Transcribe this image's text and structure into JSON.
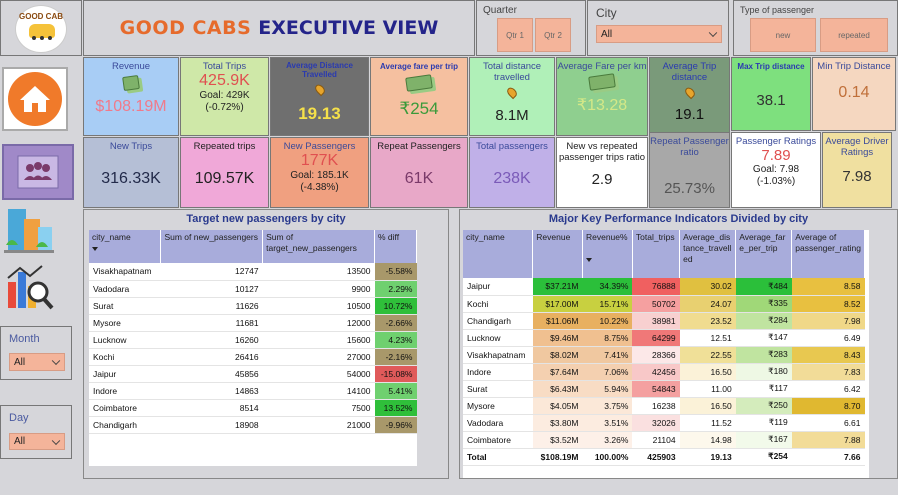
{
  "logo": {
    "text": "GOOD CAB"
  },
  "header": {
    "title_part1": "GOOD CABS",
    "title_part2": "EXECUTIVE VIEW"
  },
  "slicers": {
    "quarter": {
      "title": "Quarter",
      "options": [
        "Qtr 1",
        "Qtr 2"
      ]
    },
    "city": {
      "title": "City",
      "value": "All"
    },
    "passenger_type": {
      "title": "Type of passenger",
      "options": [
        "new",
        "repeated"
      ]
    },
    "month": {
      "title": "Month",
      "value": "All"
    },
    "day": {
      "title": "Day",
      "value": "All"
    }
  },
  "nav": [
    {
      "name": "home-icon"
    },
    {
      "name": "passengers-icon"
    },
    {
      "name": "city-buildings-icon"
    },
    {
      "name": "analytics-icon"
    }
  ],
  "kpis": {
    "revenue": {
      "title": "Revenue",
      "value": "$108.19M",
      "bg": "#a8cdf5"
    },
    "total_trips": {
      "title": "Total Trips",
      "value": "425.9K",
      "goal": "Goal: 429K",
      "diff": "(-0.72%)",
      "bg": "#cfe8a8"
    },
    "avg_distance": {
      "title": "Average Distance Travelled",
      "value": "19.13",
      "bg": "#6f6f6f"
    },
    "avg_fare": {
      "title": "Average fare per trip",
      "value": "₹254",
      "bg": "#f5c0a0"
    },
    "total_distance": {
      "title": "Total distance travelled",
      "value": "8.1M",
      "bg": "#b0f0b8"
    },
    "avg_fare_km": {
      "title": "Average Fare per km",
      "value": "₹13.28",
      "bg": "#8fcf8f"
    },
    "avg_trip_distance": {
      "title": "Average Trip distance",
      "value": "19.1",
      "bg": "#7a9a7a"
    },
    "max_trip_distance": {
      "title": "Max Trip distance",
      "value": "38.1",
      "bg": "#7ee07e"
    },
    "min_trip_distance": {
      "title": "Min Trip Distance",
      "value": "0.14",
      "bg": "#f5d7c0"
    },
    "new_trips": {
      "title": "New Trips",
      "value": "316.33K",
      "bg": "#b5bfd6"
    },
    "repeated_trips": {
      "title": "Repeated trips",
      "value": "109.57K",
      "bg": "#f0a8d8"
    },
    "new_passengers": {
      "title": "New Passengers",
      "value": "177K",
      "goal": "Goal: 185.1K",
      "diff": "(-4.38%)",
      "bg": "#f0a080"
    },
    "repeat_passengers": {
      "title": "Repeat Passengers",
      "value": "61K",
      "bg": "#e8a8c8"
    },
    "total_passengers": {
      "title": "Total passengers",
      "value": "238K",
      "bg": "#c0b0e8"
    },
    "new_vs_repeated_ratio": {
      "title": "New vs repeated passenger trips ratio",
      "value": "2.9",
      "bg": "#ffffff"
    },
    "repeat_ratio": {
      "title": "Repeat Passenger ratio",
      "value": "25.73%",
      "bg": "#a8a8a8"
    },
    "passenger_ratings": {
      "title": "Passenger Ratings",
      "value": "7.89",
      "goal": "Goal: 7.98",
      "diff": "(-1.03%)",
      "bg": "#ffffff"
    },
    "driver_ratings": {
      "title": "Average Driver Ratings",
      "value": "7.98",
      "bg": "#f0e0a0"
    }
  },
  "target_table": {
    "title": "Target new passengers by city",
    "headers": [
      "city_name",
      "Sum of new_passengers",
      "Sum of target_new_passengers",
      "% diff"
    ],
    "rows": [
      {
        "city": "Visakhapatnam",
        "new": "12747",
        "target": "13500",
        "diff": "-5.58%",
        "pct": -5.58
      },
      {
        "city": "Vadodara",
        "new": "10127",
        "target": "9900",
        "diff": "2.29%",
        "pct": 2.29
      },
      {
        "city": "Surat",
        "new": "11626",
        "target": "10500",
        "diff": "10.72%",
        "pct": 10.72
      },
      {
        "city": "Mysore",
        "new": "11681",
        "target": "12000",
        "diff": "-2.66%",
        "pct": -2.66
      },
      {
        "city": "Lucknow",
        "new": "16260",
        "target": "15600",
        "diff": "4.23%",
        "pct": 4.23
      },
      {
        "city": "Kochi",
        "new": "26416",
        "target": "27000",
        "diff": "-2.16%",
        "pct": -2.16
      },
      {
        "city": "Jaipur",
        "new": "45856",
        "target": "54000",
        "diff": "-15.08%",
        "pct": -15.08
      },
      {
        "city": "Indore",
        "new": "14863",
        "target": "14100",
        "diff": "5.41%",
        "pct": 5.41
      },
      {
        "city": "Coimbatore",
        "new": "8514",
        "target": "7500",
        "diff": "13.52%",
        "pct": 13.52
      },
      {
        "city": "Chandigarh",
        "new": "18908",
        "target": "21000",
        "diff": "-9.96%",
        "pct": -9.96
      }
    ]
  },
  "kpi_table": {
    "title": "Major Key Performance Indicators Divided by city",
    "headers": [
      "city_name",
      "Revenue",
      "Revenue%",
      "Total_trips",
      "Average_distance_travelled",
      "Average_fare_per_trip",
      "Average of passenger_rating"
    ],
    "rows": [
      {
        "city": "Jaipur",
        "revenue": "$37.21M",
        "rev_pct": "34.39%",
        "trips": "76888",
        "dist": "30.02",
        "fare": "₹484",
        "rating": "8.58",
        "colors": [
          "#2bbf3a",
          "#2bbf3a",
          "#f06060",
          "#e0c040",
          "#2bbf3a",
          "#e8c040"
        ]
      },
      {
        "city": "Kochi",
        "revenue": "$17.00M",
        "rev_pct": "15.71%",
        "trips": "50702",
        "dist": "24.07",
        "fare": "₹335",
        "rating": "8.52",
        "colors": [
          "#c8d040",
          "#c8d040",
          "#f5a0a0",
          "#e8d070",
          "#a0d878",
          "#e8c040"
        ]
      },
      {
        "city": "Chandigarh",
        "revenue": "$11.06M",
        "rev_pct": "10.22%",
        "trips": "38981",
        "dist": "23.52",
        "fare": "₹284",
        "rating": "7.98",
        "colors": [
          "#e8b060",
          "#e8b060",
          "#f8d0d0",
          "#f0dc90",
          "#c0e4a0",
          "#f0d888"
        ]
      },
      {
        "city": "Lucknow",
        "revenue": "$9.46M",
        "rev_pct": "8.75%",
        "trips": "64299",
        "dist": "12.51",
        "fare": "₹147",
        "rating": "6.49",
        "colors": [
          "#f0c090",
          "#f0c090",
          "#f07878",
          "#ffffff",
          "#ffffff",
          "#ffffff"
        ]
      },
      {
        "city": "Visakhapatnam",
        "revenue": "$8.02M",
        "rev_pct": "7.41%",
        "trips": "28366",
        "dist": "22.55",
        "fare": "₹283",
        "rating": "8.43",
        "colors": [
          "#f0c8a0",
          "#f0c8a0",
          "#fce8e8",
          "#f0e098",
          "#c0e4a0",
          "#e8c850"
        ]
      },
      {
        "city": "Indore",
        "revenue": "$7.64M",
        "rev_pct": "7.06%",
        "trips": "42456",
        "dist": "16.50",
        "fare": "₹180",
        "rating": "7.83",
        "colors": [
          "#f4d0b0",
          "#f4d0b0",
          "#f8c8c8",
          "#fbf2d8",
          "#eef8e4",
          "#f2dc98"
        ]
      },
      {
        "city": "Surat",
        "revenue": "$6.43M",
        "rev_pct": "5.94%",
        "trips": "54843",
        "dist": "11.00",
        "fare": "₹117",
        "rating": "6.42",
        "colors": [
          "#f8dcc4",
          "#f8dcc4",
          "#f4a0a0",
          "#ffffff",
          "#ffffff",
          "#ffffff"
        ]
      },
      {
        "city": "Mysore",
        "revenue": "$4.05M",
        "rev_pct": "3.75%",
        "trips": "16238",
        "dist": "16.50",
        "fare": "₹250",
        "rating": "8.70",
        "colors": [
          "#fbe8d8",
          "#fbe8d8",
          "#ffffff",
          "#fbf2d8",
          "#d4ecbc",
          "#e0b830"
        ]
      },
      {
        "city": "Vadodara",
        "revenue": "$3.80M",
        "rev_pct": "3.51%",
        "trips": "32026",
        "dist": "11.52",
        "fare": "₹119",
        "rating": "6.61",
        "colors": [
          "#fcece0",
          "#fcece0",
          "#fae0e0",
          "#ffffff",
          "#ffffff",
          "#ffffff"
        ]
      },
      {
        "city": "Coimbatore",
        "revenue": "$3.52M",
        "rev_pct": "3.26%",
        "trips": "21104",
        "dist": "14.98",
        "fare": "₹167",
        "rating": "7.88",
        "colors": [
          "#fdf0e8",
          "#fdf0e8",
          "#ffffff",
          "#fdf8ec",
          "#f2faea",
          "#f2dc98"
        ]
      }
    ],
    "total": {
      "city": "Total",
      "revenue": "$108.19M",
      "rev_pct": "100.00%",
      "trips": "425903",
      "dist": "19.13",
      "fare": "₹254",
      "rating": "7.66"
    }
  }
}
